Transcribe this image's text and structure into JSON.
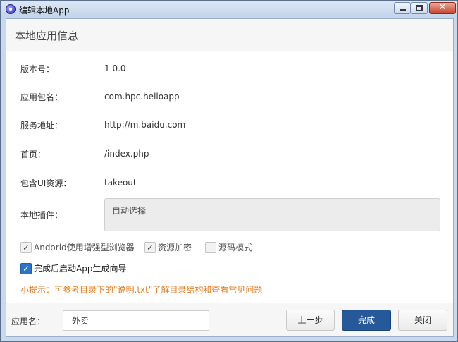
{
  "window": {
    "title": "编辑本地App",
    "close_glyph": "✕"
  },
  "header": {
    "title": "本地应用信息"
  },
  "fields": [
    {
      "label": "版本号：",
      "value": "1.0.0"
    },
    {
      "label": "应用包名：",
      "value": "com.hpc.helloapp"
    },
    {
      "label": "服务地址：",
      "value": "http://m.baidu.com"
    },
    {
      "label": "首页：",
      "value": "/index.php"
    },
    {
      "label": "包含UI资源：",
      "value": "takeout"
    }
  ],
  "plugin": {
    "label": "本地插件：",
    "value": "自动选择"
  },
  "options": {
    "browser": {
      "label": "Andorid使用增强型浏览器",
      "checked": true,
      "enabled": false
    },
    "encrypt": {
      "label": "资源加密",
      "checked": true,
      "enabled": false
    },
    "source": {
      "label": "源码模式",
      "checked": false,
      "enabled": false
    },
    "wizard": {
      "label": "完成后启动App生成向导",
      "checked": true,
      "enabled": true
    },
    "check_mark": "✓"
  },
  "tip": "小提示：可参考目录下的\"说明.txt\"了解目录结构和查看常见问题",
  "footer": {
    "app_name_label": "应用名：",
    "app_name_value": "外卖",
    "prev_label": "上一步",
    "done_label": "完成",
    "close_label": "关闭"
  },
  "colors": {
    "primary_button": "#26599a",
    "tip_text": "#e07b1c",
    "checkbox_checked": "#2c74c7"
  }
}
